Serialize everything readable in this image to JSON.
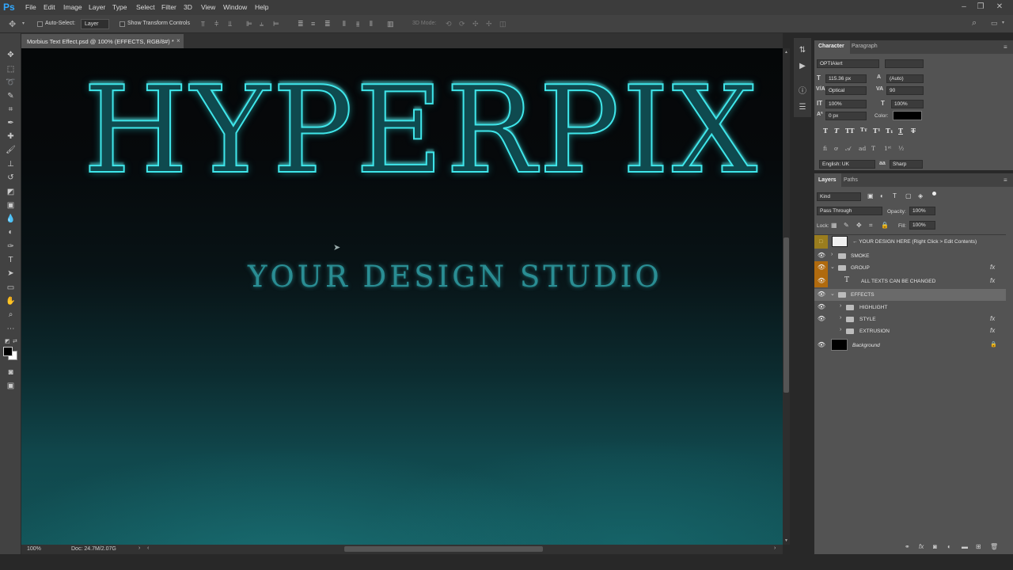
{
  "app": {
    "logo": "Ps"
  },
  "menu": [
    "File",
    "Edit",
    "Image",
    "Layer",
    "Type",
    "Select",
    "Filter",
    "3D",
    "View",
    "Window",
    "Help"
  ],
  "options": {
    "auto_select_label": "Auto-Select:",
    "auto_select_value": "Layer",
    "transform_label": "Show Transform Controls",
    "mode_label": "3D Mode:"
  },
  "document": {
    "tab_title": "Morbius Text Effect.psd @ 100% (EFFECTS, RGB/8#) *",
    "close": "×"
  },
  "canvas": {
    "headline": "HYPERPIX",
    "subtitle": "YOUR DESIGN STUDIO"
  },
  "status": {
    "zoom": "100%",
    "doc": "Doc: 24.7M/2.07G"
  },
  "character": {
    "tabs": [
      "Character",
      "Paragraph"
    ],
    "font_family": "OPTIAlert",
    "font_size": "115.36 px",
    "leading": "(Auto)",
    "kerning": "Optical",
    "tracking": "90",
    "vscale": "100%",
    "hscale": "100%",
    "baseline": "0 px",
    "color_label": "Color:",
    "color_value": "#000000",
    "language": "English: UK",
    "antialias": "Sharp"
  },
  "layers": {
    "tabs": [
      "Layers",
      "Paths"
    ],
    "kind": "Kind",
    "blend": "Pass Through",
    "opacity_label": "Opacity:",
    "opacity": "100%",
    "lock_label": "Lock:",
    "fill_label": "Fill:",
    "fill": "100%",
    "items": [
      {
        "name": "← YOUR DESIGN HERE (Right Click > Edit Contents)"
      },
      {
        "name": "SMOKE"
      },
      {
        "name": "GROUP"
      },
      {
        "name": "ALL TEXTS CAN BE CHANGED"
      },
      {
        "name": "EFFECTS"
      },
      {
        "name": "HIGHLIGHT"
      },
      {
        "name": "STYLE"
      },
      {
        "name": "EXTRUSION"
      },
      {
        "name": "Background"
      }
    ],
    "fx": "fx"
  },
  "colors": {
    "accent": "#3fe6ea",
    "panel": "#535353",
    "highlight": "#b08a2a"
  }
}
